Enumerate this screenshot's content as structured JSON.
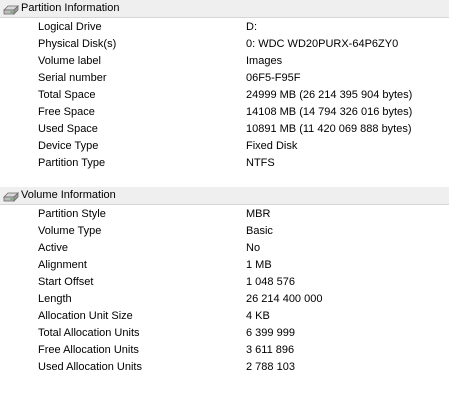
{
  "partition": {
    "header": "Partition Information",
    "rows": [
      {
        "label": "Logical Drive",
        "value": "D:"
      },
      {
        "label": "Physical Disk(s)",
        "value": "0: WDC WD20PURX-64P6ZY0"
      },
      {
        "label": "Volume label",
        "value": "Images"
      },
      {
        "label": "Serial number",
        "value": "06F5-F95F"
      },
      {
        "label": "Total Space",
        "value": "24999 MB (26 214 395 904 bytes)"
      },
      {
        "label": "Free Space",
        "value": "14108 MB (14 794 326 016 bytes)"
      },
      {
        "label": "Used Space",
        "value": "10891 MB (11 420 069 888 bytes)"
      },
      {
        "label": "Device Type",
        "value": "Fixed Disk"
      },
      {
        "label": "Partition Type",
        "value": "NTFS"
      }
    ]
  },
  "volume": {
    "header": "Volume Information",
    "rows": [
      {
        "label": "Partition Style",
        "value": "MBR"
      },
      {
        "label": "Volume Type",
        "value": "Basic"
      },
      {
        "label": "Active",
        "value": "No"
      },
      {
        "label": "Alignment",
        "value": "1 MB"
      },
      {
        "label": "Start Offset",
        "value": "1 048 576"
      },
      {
        "label": "Length",
        "value": "26 214 400 000"
      },
      {
        "label": "Allocation Unit Size",
        "value": "4 KB"
      },
      {
        "label": "Total Allocation Units",
        "value": "6 399 999"
      },
      {
        "label": "Free Allocation Units",
        "value": "3 611 896"
      },
      {
        "label": "Used Allocation Units",
        "value": "2 788 103"
      }
    ]
  },
  "icons": {
    "group_header_icon": "drive-icon"
  }
}
